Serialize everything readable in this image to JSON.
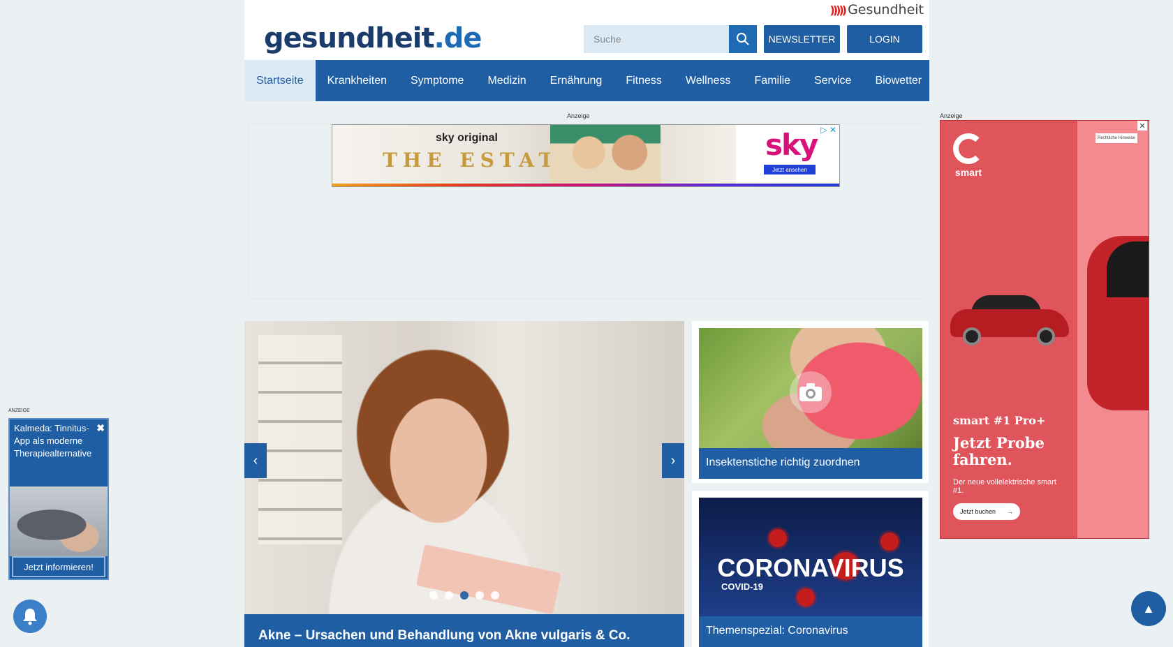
{
  "header": {
    "network_label": "Gesundheit",
    "logo_main": "gesundheit",
    "logo_tld": ".de",
    "search_placeholder": "Suche",
    "newsletter_label": "NEWSLETTER",
    "login_label": "LOGIN"
  },
  "nav": {
    "items": [
      {
        "label": "Startseite",
        "active": true
      },
      {
        "label": "Krankheiten"
      },
      {
        "label": "Symptome"
      },
      {
        "label": "Medizin"
      },
      {
        "label": "Ernährung"
      },
      {
        "label": "Fitness"
      },
      {
        "label": "Wellness"
      },
      {
        "label": "Familie"
      },
      {
        "label": "Service"
      },
      {
        "label": "Biowetter"
      }
    ]
  },
  "ads": {
    "anzeige_label": "Anzeige",
    "anzeige_label_small": "ANZEIGE",
    "banner": {
      "kicker": "sky original",
      "title": "THE ESTATE",
      "brand": "sky",
      "cta": "Jetzt ansehen"
    },
    "right": {
      "brand": "smart",
      "model": "smart #1 Pro+",
      "headline": "Jetzt Probe fahren.",
      "sub": "Der neue vollelektrische smart #1.",
      "cta": "Jetzt buchen",
      "legal": "Rechtliche Hinweise"
    }
  },
  "hero": {
    "caption": "Akne – Ursachen und Behandlung von Akne vulgaris & Co.",
    "prev": "‹",
    "next": "›",
    "dots_total": 5,
    "dots_active_index": 2
  },
  "tiles": [
    {
      "caption": "Insektenstiche richtig zuordnen"
    },
    {
      "caption": "Themenspezial: Coronavirus",
      "image_title": "CORONAVIRUS",
      "image_sub": "COVID-19"
    }
  ],
  "promo": {
    "text": "Kalmeda: Tinnitus-App als moderne Therapiealternative",
    "button": "Jetzt informieren!"
  },
  "colors": {
    "primary": "#1f5ea3",
    "background": "#ebf1f3",
    "ad_red": "#e0545c"
  }
}
